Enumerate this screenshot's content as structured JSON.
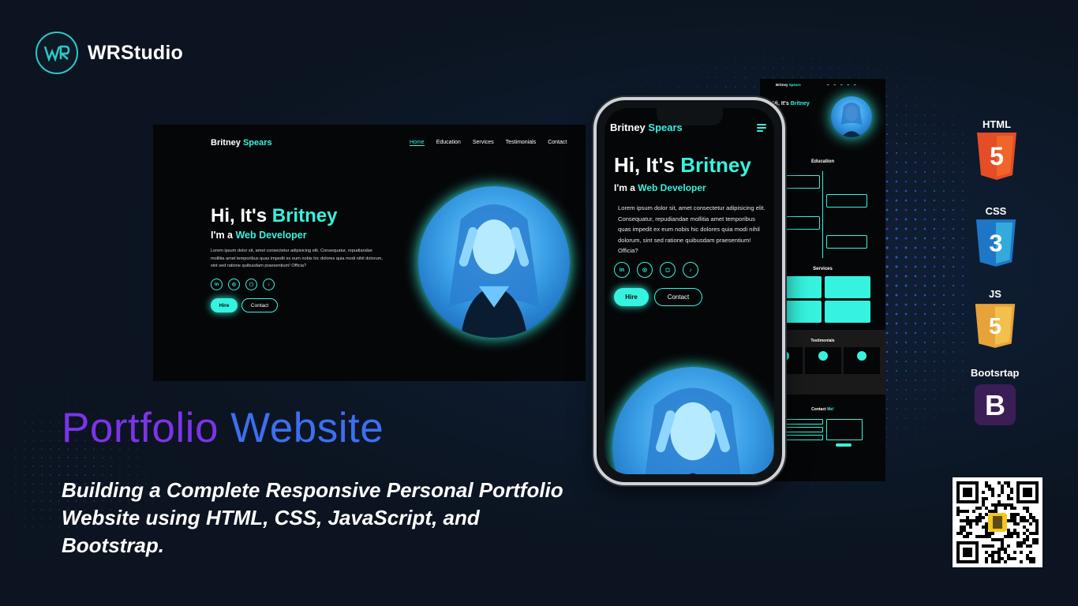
{
  "brand": {
    "name": "WRStudio",
    "mark": "WR"
  },
  "desktop": {
    "logo_first": "Britney",
    "logo_second": "Spears",
    "nav": [
      "Home",
      "Education",
      "Services",
      "Testimonials",
      "Contact"
    ],
    "hello_prefix": "Hi, It's",
    "hello_name": "Britney",
    "role_prefix": "I'm a",
    "role_title": "Web Developer",
    "paragraph": "Lorem ipsum dolor sit, amet consectetur adipisicing elit. Consequatur, repudiandae mollitia amet temporibus quas impedit ex eum nobis hic dolores quia modi nihil dolorum, sint sed ratione quibusdam praesentium! Officia?",
    "socials": [
      "in",
      "gh",
      "ig",
      "tk"
    ],
    "hire_label": "Hire",
    "contact_label": "Contact"
  },
  "phone": {
    "logo_first": "Britney",
    "logo_second": "Spears",
    "hello_prefix": "Hi, It's",
    "hello_name": "Britney",
    "role_prefix": "I'm a",
    "role_title": "Web Developer",
    "paragraph": "Lorem ipsum dolor sit, amet consectetur adipisicing elit. Consequatur, repudiandae mollitia amet temporibus quas impedit ex eum nobis hic dolores quia modi nihil dolorum, sint sed ratione quibusdam praesentium! Officia?",
    "hire_label": "Hire",
    "contact_label": "Contact"
  },
  "back": {
    "logo_first": "Britney",
    "logo_second": "Spears",
    "hello_prefix": "Hi, It's",
    "hello_name": "Britney",
    "education_title": "Education",
    "services_title": "Services",
    "testimonials_title": "Testimonials",
    "contact_title_prefix": "Contact",
    "contact_title_suffix": "Me!"
  },
  "headline": {
    "word1": "Portfolio",
    "word2": "Website"
  },
  "subtitle": "Building a Complete Responsive Personal Portfolio Website using HTML, CSS, JavaScript, and Bootstrap.",
  "tech": [
    {
      "label": "HTML",
      "icon": "html5-icon",
      "color": "#e44d26",
      "glyph": "5"
    },
    {
      "label": "CSS",
      "icon": "css3-icon",
      "color": "#1e77c6",
      "glyph": "3"
    },
    {
      "label": "JS",
      "icon": "js-icon",
      "color": "#e7a33a",
      "glyph": "5"
    },
    {
      "label": "Bootsrtap",
      "icon": "bootstrap-icon",
      "color": "#3b1e58",
      "glyph": "B"
    }
  ],
  "colors": {
    "accent": "#36f3df",
    "background": "#0b1420",
    "purple": "#7b34e8",
    "blue": "#3d6ff0"
  }
}
